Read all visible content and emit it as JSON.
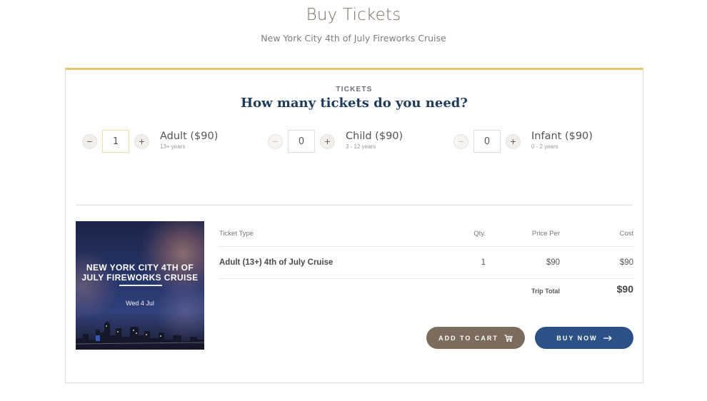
{
  "header": {
    "title": "Buy Tickets",
    "subtitle": "New York City 4th of July Fireworks Cruise"
  },
  "tickets_section": {
    "label": "TICKETS",
    "heading": "How many tickets do you need?",
    "types": [
      {
        "name": "Adult ($90)",
        "age": "13+ years",
        "quantity": "1",
        "minus": "−",
        "plus": "+"
      },
      {
        "name": "Child ($90)",
        "age": "3 - 12 years",
        "quantity": "0",
        "minus": "−",
        "plus": "+"
      },
      {
        "name": "Infant ($90)",
        "age": "0 - 2 years",
        "quantity": "0",
        "minus": "−",
        "plus": "+"
      }
    ]
  },
  "event_image": {
    "title_line1": "NEW YORK CITY 4TH OF",
    "title_line2": "JULY FIREWORKS CRUISE",
    "date": "Wed 4 Jul"
  },
  "summary": {
    "columns": {
      "type": "Ticket Type",
      "qty": "Qty.",
      "price": "Price Per",
      "cost": "Cost"
    },
    "rows": [
      {
        "type": "Adult (13+) 4th of July Cruise",
        "qty": "1",
        "price": "$90",
        "cost": "$90"
      }
    ],
    "total_label": "Trip Total",
    "total_value": "$90"
  },
  "actions": {
    "add_to_cart": "ADD TO CART",
    "add_to_cart_icon": "cart-icon",
    "buy_now": "BUY NOW",
    "buy_now_icon": "arrow-right-icon"
  },
  "colors": {
    "accent_gold": "#e6c66c",
    "heading_navy": "#1f3b5a",
    "cart_button": "#7c6c5e",
    "buy_button": "#2b5186"
  }
}
